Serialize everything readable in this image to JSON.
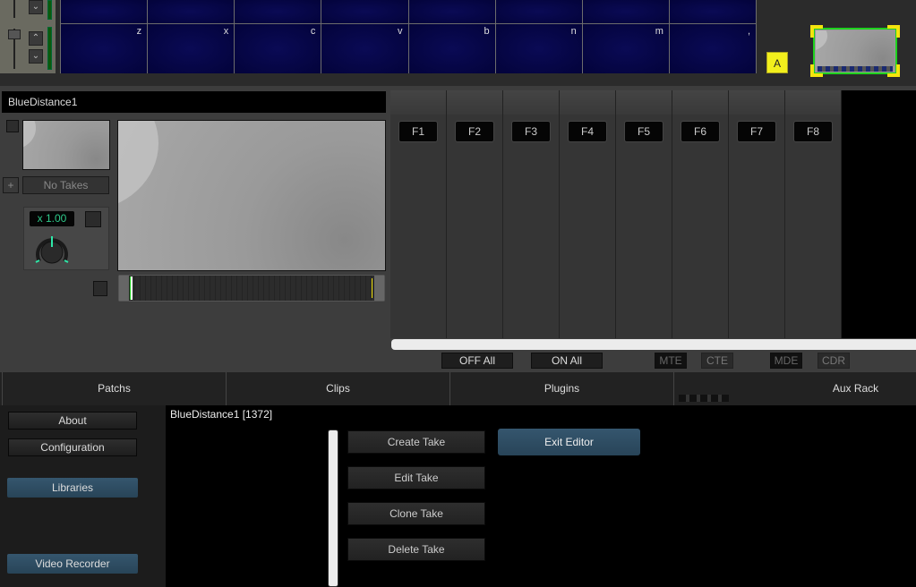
{
  "keyboard": {
    "top_row_keys": [
      "",
      "",
      "",
      "",
      "",
      "",
      "",
      ""
    ],
    "bottom_row_keys": [
      "z",
      "x",
      "c",
      "v",
      "b",
      "n",
      "m",
      ","
    ]
  },
  "bank_button": "A",
  "clip": {
    "name": "BlueDistance1",
    "takes_label": "No Takes",
    "add_take_symbol": "+",
    "speed": "x 1.00"
  },
  "fx_slots": [
    "F1",
    "F2",
    "F3",
    "F4",
    "F5",
    "F6",
    "F7",
    "F8"
  ],
  "fx_controls": {
    "off_all": "OFF All",
    "on_all": "ON All",
    "toggles": [
      "MTE",
      "CTE",
      "MDE",
      "CDR"
    ]
  },
  "tabs": [
    "Patchs",
    "Clips",
    "Plugins",
    "Aux Rack"
  ],
  "sidebar": {
    "about": "About",
    "configuration": "Configuration",
    "libraries": "Libraries",
    "video_recorder": "Video Recorder"
  },
  "editor": {
    "title": "BlueDistance1 [1372]",
    "create_take": "Create Take",
    "edit_take": "Edit Take",
    "clone_take": "Clone Take",
    "delete_take": "Delete Take",
    "exit_editor": "Exit Editor"
  },
  "colors": {
    "accent_blue": "#2f4f66",
    "speed_text": "#2ec98a",
    "bank_yellow": "#f2ef1c"
  }
}
